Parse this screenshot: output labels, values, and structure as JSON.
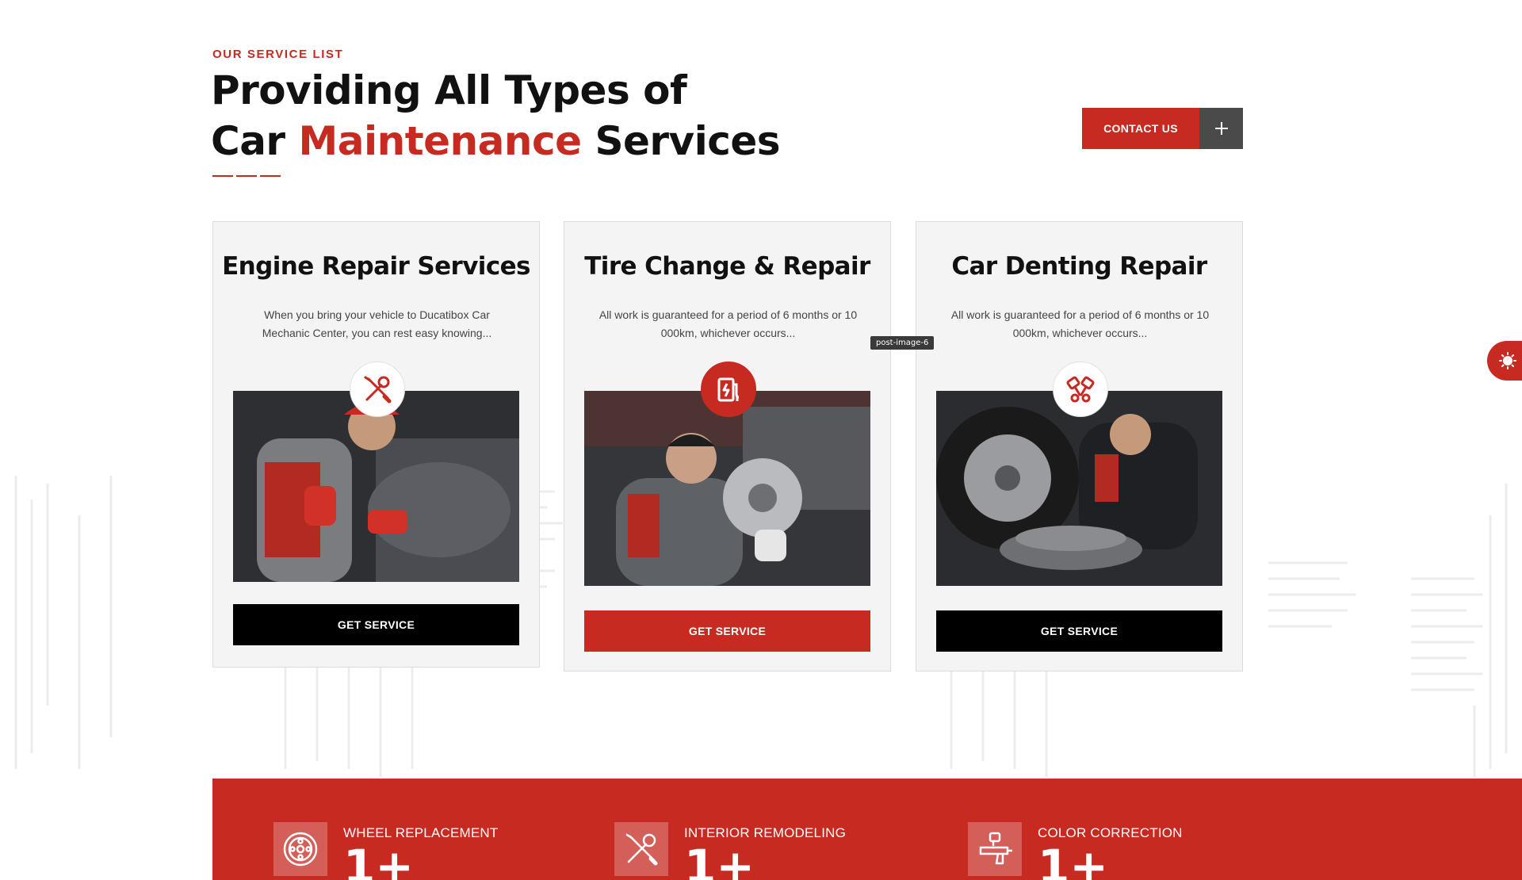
{
  "header": {
    "eyebrow": "OUR SERVICE LIST",
    "title_line1": "Providing All Types of",
    "title_line2_prefix": "Car ",
    "title_line2_accent": "Maintenance",
    "title_line2_suffix": " Services",
    "contact_label": "CONTACT US"
  },
  "cards": [
    {
      "title": "Engine Repair Services",
      "description": "When you bring your vehicle to Ducatibox Car Mechanic Center, you can rest easy knowing...",
      "icon": "wrench-screwdriver-icon",
      "button_label": "GET SERVICE",
      "button_style": "black"
    },
    {
      "title": "Tire Change & Repair",
      "description": "All work is guaranteed for a period of 6 months or 10 000km, whichever occurs...",
      "icon": "ev-charger-icon",
      "button_label": "GET SERVICE",
      "button_style": "red"
    },
    {
      "title": "Car Denting Repair",
      "description": "All work is guaranteed for a period of 6 months or 10 000km, whichever occurs...",
      "icon": "pistons-icon",
      "button_label": "GET SERVICE",
      "button_style": "black"
    }
  ],
  "tooltip": "post-image-6",
  "stats": [
    {
      "label": "WHEEL REPLACEMENT",
      "value": "1+",
      "icon": "wheel-icon"
    },
    {
      "label": "INTERIOR REMODELING",
      "value": "1+",
      "icon": "tools-icon"
    },
    {
      "label": "COLOR CORRECTION",
      "value": "1+",
      "icon": "spray-gun-icon"
    }
  ],
  "colors": {
    "accent": "#c62a21",
    "dark": "#000000",
    "gray_button": "#4a4a4a",
    "card_bg": "#f4f4f4"
  }
}
